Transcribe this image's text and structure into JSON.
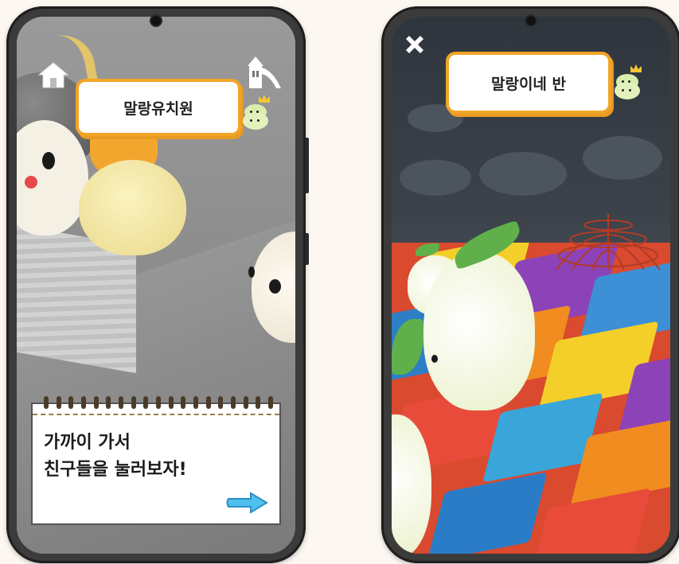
{
  "background_color": "#fdf7f2",
  "accent_color": "#f1a527",
  "left_phone": {
    "title": "말랑유치원",
    "icons": {
      "home": "home-icon",
      "playground": "slide-icon"
    },
    "notepad": {
      "line1": "가까이 가서",
      "line2": "친구들을 눌러보자!",
      "next_icon": "arrow-right-icon"
    }
  },
  "right_phone": {
    "title": "말랑이네 반",
    "icons": {
      "close": "close-icon"
    }
  }
}
